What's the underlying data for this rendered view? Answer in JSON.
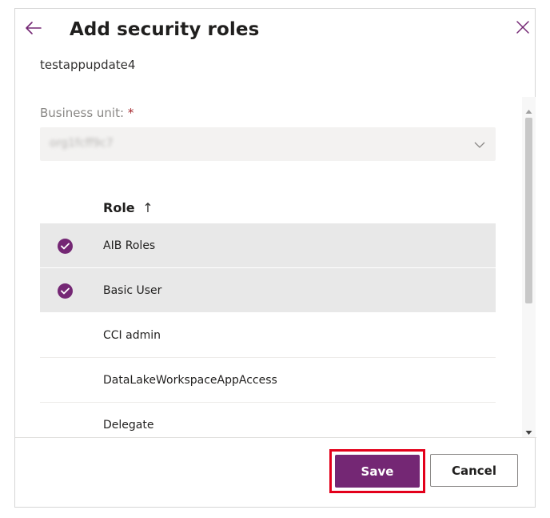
{
  "header": {
    "title": "Add security roles",
    "subtitle": "testappupdate4"
  },
  "business_unit": {
    "label": "Business unit:",
    "required_mark": "*",
    "value": "org1fcff9c7"
  },
  "roles": {
    "column_header": "Role",
    "sort_indicator": "↑",
    "items": [
      {
        "label": "AIB Roles",
        "selected": true
      },
      {
        "label": "Basic User",
        "selected": true
      },
      {
        "label": "CCI admin",
        "selected": false
      },
      {
        "label": "DataLakeWorkspaceAppAccess",
        "selected": false
      },
      {
        "label": "Delegate",
        "selected": false
      }
    ]
  },
  "footer": {
    "save_label": "Save",
    "cancel_label": "Cancel"
  },
  "colors": {
    "accent": "#742774",
    "highlight": "#e3001b"
  },
  "icons": {
    "back": "arrow-left-icon",
    "close": "close-icon",
    "dropdown": "chevron-down-icon",
    "selected": "check-circle-icon"
  }
}
